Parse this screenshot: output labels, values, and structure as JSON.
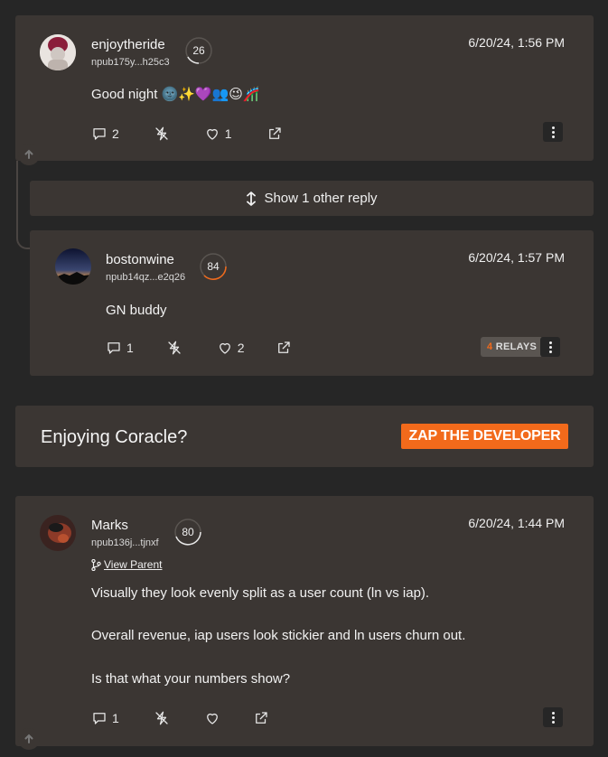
{
  "notes": [
    {
      "username": "enjoytheride",
      "npub": "npub175y...h25c3",
      "score": "26",
      "time": "6/20/24, 1:56 PM",
      "content": "Good night 🌚✨💜👥😉🎢",
      "replies": "2",
      "likes": "1"
    },
    {
      "username": "bostonwine",
      "npub": "npub14qz...e2q26",
      "score": "84",
      "time": "6/20/24, 1:57 PM",
      "content": "GN buddy",
      "replies": "1",
      "likes": "2",
      "relays_count": "4",
      "relays_label": "RELAYS"
    },
    {
      "username": "Marks",
      "npub": "npub136j...tjnxf",
      "score": "80",
      "time": "6/20/24, 1:44 PM",
      "view_parent": "View Parent",
      "content_lines": [
        "Visually they look evenly split as a user count (ln vs iap).",
        "Overall revenue, iap users look stickier and ln users churn out.",
        "Is that what your numbers show?"
      ],
      "replies": "1"
    }
  ],
  "show_replies_label": "Show 1 other reply",
  "promo": {
    "text": "Enjoying Coracle?",
    "button": "ZAP THE DEVELOPER"
  },
  "colors": {
    "accent": "#f26a1b",
    "card": "#3b3633",
    "background": "#262626"
  }
}
